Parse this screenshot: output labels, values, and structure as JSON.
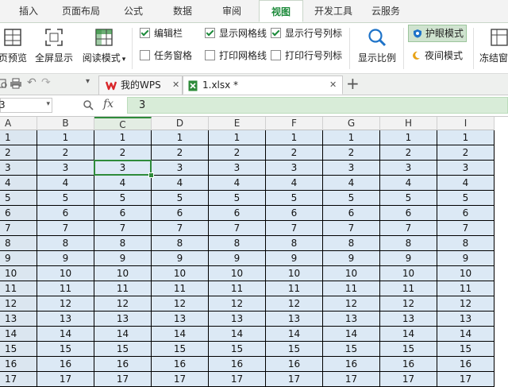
{
  "menu": {
    "tabs": [
      "插入",
      "页面布局",
      "公式",
      "数据",
      "审阅",
      "视图",
      "开发工具",
      "云服务"
    ],
    "active": "视图"
  },
  "ribbon": {
    "page_preview": "页预览",
    "fullscreen": "全屏显示",
    "reading_mode": "阅读模式",
    "edit_bar": "编辑栏",
    "task_pane": "任务窗格",
    "show_gridlines": "显示网格线",
    "print_gridlines": "打印网格线",
    "show_row_col_headers": "显示行号列标",
    "print_row_col_headers": "打印行号列标",
    "zoom": "显示比例",
    "eye_protection": "护眼模式",
    "night_mode": "夜间模式",
    "freeze": "冻结窗"
  },
  "checkboxes": {
    "edit_bar": true,
    "task_pane": false,
    "show_gridlines": true,
    "print_gridlines": false,
    "show_row_col_headers": true,
    "print_row_col_headers": false
  },
  "doc_tabs": {
    "wps_home": "我的WPS",
    "file": "1.xlsx *",
    "new_tab": "+"
  },
  "formula_bar": {
    "name_box": "3",
    "fx": "fx",
    "value": "3"
  },
  "sheet": {
    "columns": [
      "A",
      "B",
      "C",
      "D",
      "E",
      "F",
      "G",
      "H",
      "I"
    ],
    "active_column": "C",
    "active_row": 3,
    "rows": [
      [
        "1",
        "1",
        "1",
        "1",
        "1",
        "1",
        "1",
        "1",
        "1"
      ],
      [
        "2",
        "2",
        "2",
        "2",
        "2",
        "2",
        "2",
        "2",
        "2"
      ],
      [
        "3",
        "3",
        "3",
        "3",
        "3",
        "3",
        "3",
        "3",
        "3"
      ],
      [
        "4",
        "4",
        "4",
        "4",
        "4",
        "4",
        "4",
        "4",
        "4"
      ],
      [
        "5",
        "5",
        "5",
        "5",
        "5",
        "5",
        "5",
        "5",
        "5"
      ],
      [
        "6",
        "6",
        "6",
        "6",
        "6",
        "6",
        "6",
        "6",
        "6"
      ],
      [
        "7",
        "7",
        "7",
        "7",
        "7",
        "7",
        "7",
        "7",
        "7"
      ],
      [
        "8",
        "8",
        "8",
        "8",
        "8",
        "8",
        "8",
        "8",
        "8"
      ],
      [
        "9",
        "9",
        "9",
        "9",
        "9",
        "9",
        "9",
        "9",
        "9"
      ],
      [
        "10",
        "10",
        "10",
        "10",
        "10",
        "10",
        "10",
        "10",
        "10"
      ],
      [
        "11",
        "11",
        "11",
        "11",
        "11",
        "11",
        "11",
        "11",
        "11"
      ],
      [
        "12",
        "12",
        "12",
        "12",
        "12",
        "12",
        "12",
        "12",
        "12"
      ],
      [
        "13",
        "13",
        "13",
        "13",
        "13",
        "13",
        "13",
        "13",
        "13"
      ],
      [
        "14",
        "14",
        "14",
        "14",
        "14",
        "14",
        "14",
        "14",
        "14"
      ],
      [
        "15",
        "15",
        "15",
        "15",
        "15",
        "15",
        "15",
        "15",
        "15"
      ],
      [
        "16",
        "16",
        "16",
        "16",
        "16",
        "16",
        "16",
        "16",
        "16"
      ],
      [
        "17",
        "17",
        "17",
        "17",
        "17",
        "17",
        "17",
        "17",
        "17"
      ]
    ]
  },
  "colors": {
    "accent_green": "#2e8b3a",
    "cell_bg": "#dce9f5",
    "wps_red": "#d9262a"
  }
}
